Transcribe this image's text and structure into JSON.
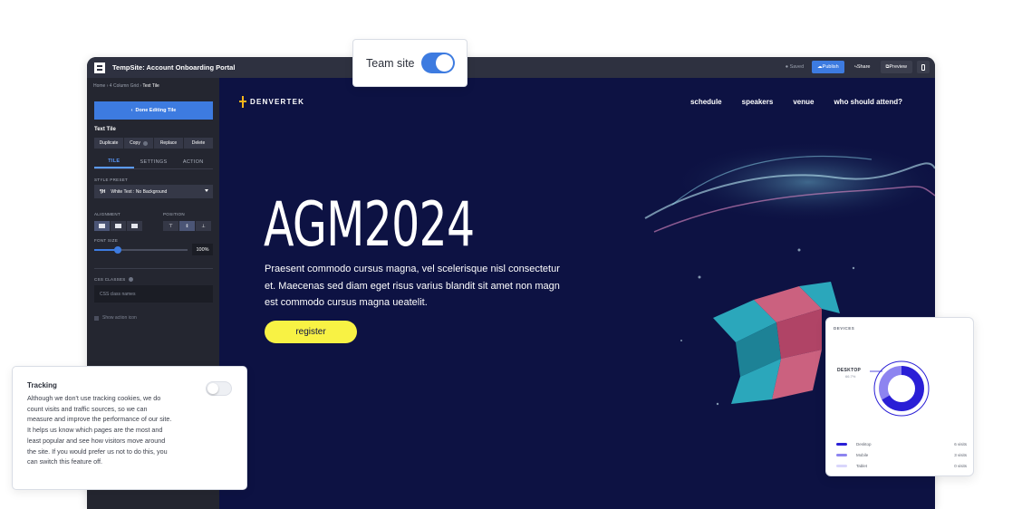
{
  "app": {
    "title": "TempSite: Account Onboarding Portal",
    "saved": "Saved",
    "publish": "Publish",
    "share": "Share",
    "preview": "Preview"
  },
  "sidebar": {
    "breadcrumb": [
      "Home",
      "4 Column Grid",
      "Text Tile"
    ],
    "done_button": "Done Editing Tile",
    "tile_title": "Text Tile",
    "actions": [
      "Duplicate",
      "Copy",
      "Replace",
      "Delete"
    ],
    "tabs": [
      "TILE",
      "SETTINGS",
      "ACTION"
    ],
    "style_preset_label": "STYLE PRESET",
    "style_preset_value": "White Text : No Background",
    "alignment_label": "ALIGNMENT",
    "position_label": "POSITION",
    "font_size_label": "FONT SIZE",
    "font_size_value": "100%",
    "font_size_fraction": 0.25,
    "css_classes_label": "CSS CLASSES",
    "css_classes_placeholder": "CSS class names",
    "show_action_icon": "Show action icon"
  },
  "hero": {
    "brand": "DENVERTEK",
    "nav": [
      "schedule",
      "speakers",
      "venue",
      "who should attend?"
    ],
    "title": "AGM2024",
    "text": "Praesent commodo cursus magna, vel scelerisque nisl consectetur et. Maecenas sed diam eget risus varius blandit sit amet non magn est commodo cursus magna ueatelit.",
    "register": "register"
  },
  "team_site": {
    "label": "Team site",
    "enabled": true
  },
  "tracking": {
    "title": "Tracking",
    "body": "Although we don't use tracking cookies, we do count visits and traffic sources, so we can measure and improve the performance of our site. It helps us know which pages are the most and least popular and see how visitors move around the site. If you would prefer us not to do this, you can switch this feature off.",
    "enabled": false
  },
  "devices": {
    "title": "DEVICES",
    "desktop_label": "DESKTOP",
    "desktop_pct": "66.7%",
    "colors": {
      "desktop": "#2a1fd6",
      "mobile": "#8d84f0",
      "tablet": "#d9d6fb"
    },
    "legend": [
      {
        "label": "Desktop",
        "value": "6 visits"
      },
      {
        "label": "Mobile",
        "value": "3 visits"
      },
      {
        "label": "Tablet",
        "value": "0 visits"
      }
    ]
  }
}
